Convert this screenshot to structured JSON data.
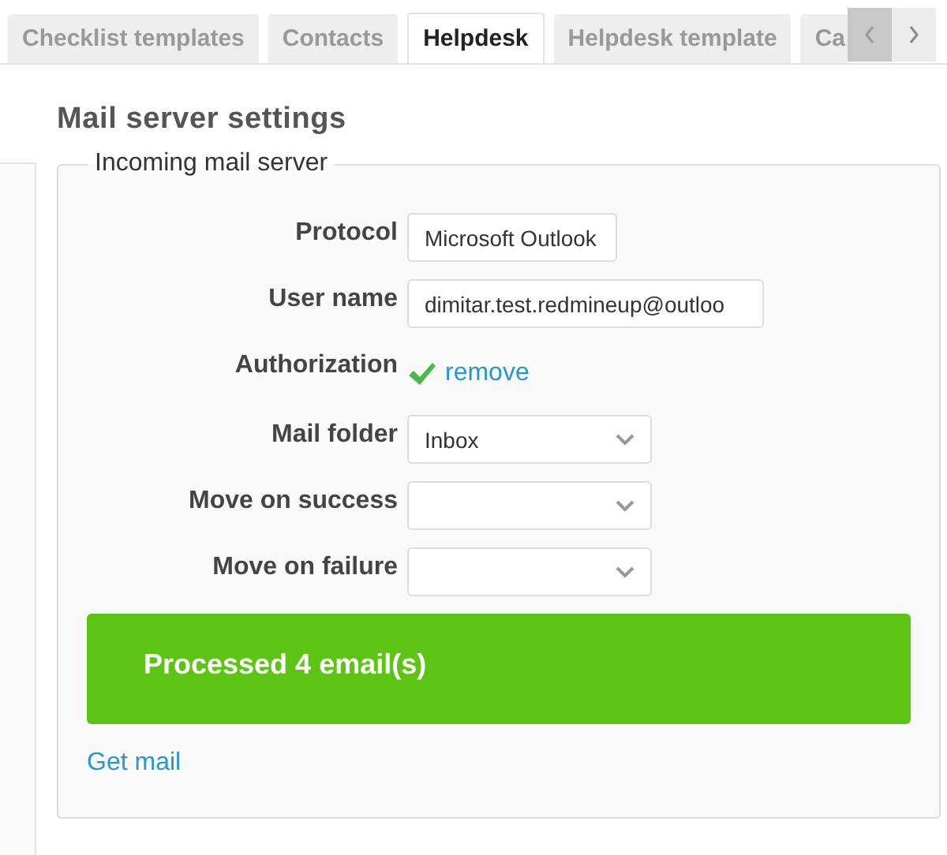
{
  "tabs": [
    {
      "label": "Checklist templates",
      "selected": false
    },
    {
      "label": "Contacts",
      "selected": false
    },
    {
      "label": "Helpdesk",
      "selected": true
    },
    {
      "label": "Helpdesk template",
      "selected": false
    },
    {
      "label": "Ca",
      "selected": false
    }
  ],
  "title": "Mail server settings",
  "fieldset": {
    "legend": "Incoming mail server",
    "rows": [
      {
        "kind": "combo",
        "label": "Protocol",
        "value": "Microsoft Outlook"
      },
      {
        "kind": "text",
        "label": "User name",
        "value": "dimitar.test.redmineup@outloo"
      },
      {
        "kind": "auth",
        "label": "Authorization",
        "checked": true,
        "link": "remove"
      },
      {
        "kind": "select",
        "label": "Mail folder",
        "value": "Inbox"
      },
      {
        "kind": "select",
        "label": "Move on success"
      },
      {
        "kind": "select",
        "label": "Move on failure"
      }
    ],
    "flash": "Processed 4 email(s)",
    "link": "Get mail"
  }
}
